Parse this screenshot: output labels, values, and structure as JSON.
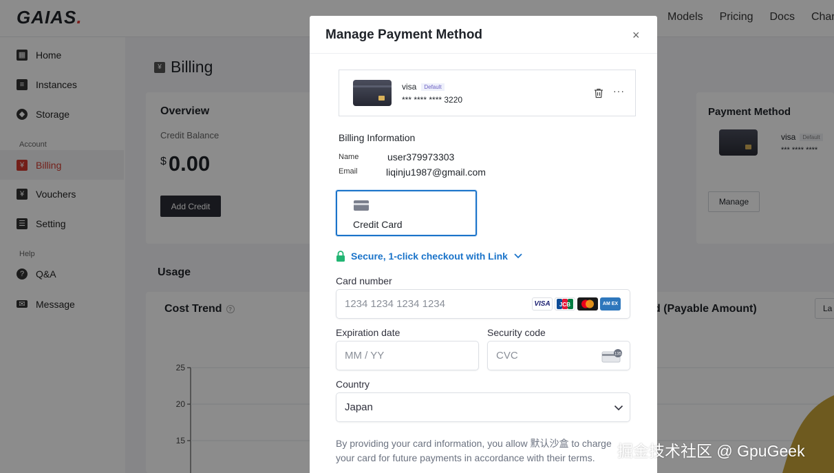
{
  "app": {
    "logo": "GAIAS",
    "logo_dot": ".",
    "nav": [
      "Models",
      "Pricing",
      "Docs",
      "Chan"
    ]
  },
  "sidebar": {
    "items": [
      {
        "label": "Home",
        "icon": "grid-icon"
      },
      {
        "label": "Instances",
        "icon": "list-icon"
      },
      {
        "label": "Storage",
        "icon": "storage-icon"
      },
      {
        "label": "Billing",
        "icon": "yen-icon",
        "active": true
      },
      {
        "label": "Vouchers",
        "icon": "voucher-icon"
      },
      {
        "label": "Setting",
        "icon": "clipboard-icon"
      },
      {
        "label": "Q&A",
        "icon": "qa-icon"
      },
      {
        "label": "Message",
        "icon": "mail-icon"
      }
    ],
    "groups": {
      "account": "Account",
      "help": "Help"
    }
  },
  "page": {
    "title": "Billing",
    "overview": {
      "title": "Overview",
      "credit_label": "Credit Balance",
      "currency": "$",
      "amount": "0.00",
      "add_credit": "Add Credit"
    },
    "payment_method": {
      "title": "Payment Method",
      "brand": "visa",
      "default": "Default",
      "digits": "*** **** ****",
      "manage": "Manage"
    },
    "usage": {
      "title": "Usage",
      "cost_trend": "Cost Trend",
      "payable_title": "d (Payable Amount)",
      "last_select": "La"
    }
  },
  "chart_data": {
    "type": "area",
    "title": "Cost Trend",
    "y_ticks": [
      "25",
      "20",
      "15"
    ],
    "ylim": [
      15,
      25
    ]
  },
  "modal": {
    "title": "Manage Payment Method",
    "close": "×",
    "saved_card": {
      "brand": "visa",
      "default": "Default",
      "number": "*** **** **** 3220",
      "more": "···"
    },
    "billing": {
      "title": "Billing Information",
      "name_label": "Name",
      "name_value": "user379973303",
      "email_label": "Email",
      "email_value": "liqinju1987@gmail.com"
    },
    "credit_card_tab": "Credit Card",
    "link_text": "Secure, 1-click checkout with Link",
    "card_number": {
      "label": "Card number",
      "placeholder": "1234 1234 1234 1234"
    },
    "brands": {
      "visa": "VISA",
      "jcb": "JCB",
      "amex": "AM EX"
    },
    "expiry": {
      "label": "Expiration date",
      "placeholder": "MM / YY"
    },
    "cvc": {
      "label": "Security code",
      "placeholder": "CVC",
      "badge": "135"
    },
    "country": {
      "label": "Country",
      "value": "Japan"
    },
    "footer": "By providing your card information, you allow 默认沙盒 to charge your card for future payments in accordance with their terms."
  },
  "watermark": "掘金技术社区 @ GpuGeek",
  "colors": {
    "accent": "#1a73c9",
    "active_red": "#d23a2f",
    "link_green": "#22b573",
    "dark_button": "#2b2d36"
  }
}
